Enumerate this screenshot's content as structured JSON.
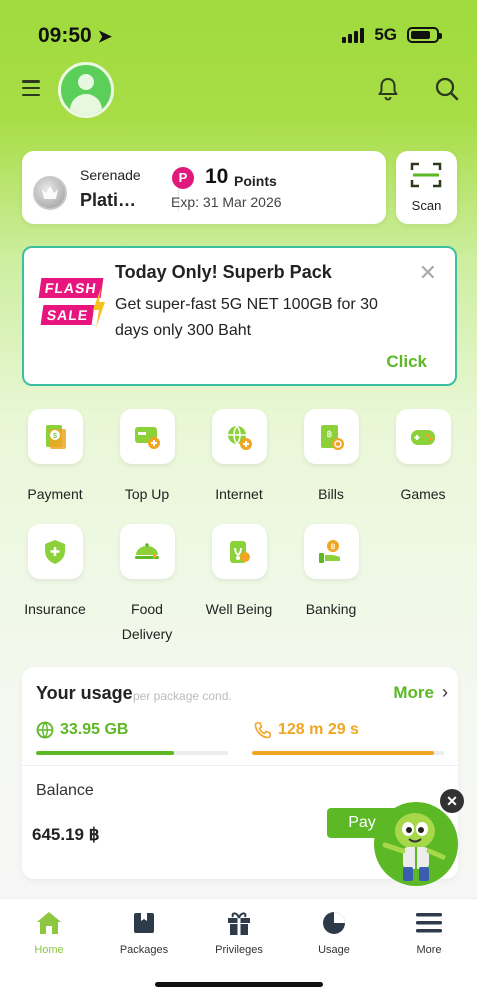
{
  "status_bar": {
    "time": "09:50",
    "location_icon": "location-arrow-icon",
    "network": "5G",
    "battery_level": 0.8
  },
  "header": {
    "menu_icon": "menu-icon",
    "avatar_icon": "avatar-icon",
    "notification_icon": "bell-icon",
    "search_icon": "search-icon"
  },
  "points": {
    "tier_name": "Serenade",
    "tier_level": "Plati…",
    "points_value": "10",
    "points_unit": "Points",
    "points_badge": "P",
    "expiry": "Exp: 31 Mar 2026"
  },
  "scan": {
    "label": "Scan",
    "icon": "scan-icon"
  },
  "promo": {
    "badge_line1": "FLASH",
    "badge_line2": "SALE",
    "title": "Today Only! Superb Pack",
    "description": "Get super-fast 5G NET 100GB for 30 days only 300 Baht",
    "cta": "Click",
    "close": "✕"
  },
  "services": [
    {
      "label": "Payment",
      "icon": "payment-icon"
    },
    {
      "label": "Top Up",
      "icon": "top-up-icon"
    },
    {
      "label": "Internet",
      "icon": "internet-icon"
    },
    {
      "label": "Bills",
      "icon": "bills-icon"
    },
    {
      "label": "Games",
      "icon": "games-icon"
    },
    {
      "label": "Insurance",
      "icon": "insurance-icon"
    },
    {
      "label": "Food Delivery",
      "icon": "food-delivery-icon"
    },
    {
      "label": "Well Being",
      "icon": "well-being-icon"
    },
    {
      "label": "Banking",
      "icon": "banking-icon"
    }
  ],
  "usage": {
    "title": "Your usage",
    "subtitle": "per package cond.",
    "more": "More",
    "data_value": "33.95 GB",
    "data_progress": 0.72,
    "call_value": "128 m 29 s",
    "call_progress": 0.95,
    "balance_label": "Balance",
    "balance_value": "645.19 ฿",
    "pay_label": "Pay"
  },
  "tabs": [
    {
      "label": "Home",
      "icon": "home-icon",
      "active": true
    },
    {
      "label": "Packages",
      "icon": "packages-icon",
      "active": false
    },
    {
      "label": "Privileges",
      "icon": "gift-icon",
      "active": false
    },
    {
      "label": "Usage",
      "icon": "pie-chart-icon",
      "active": false
    },
    {
      "label": "More",
      "icon": "more-menu-icon",
      "active": false
    }
  ],
  "colors": {
    "accent_green": "#5cb825",
    "header_green": "#9fdb3d",
    "promo_border": "#3cbfa1",
    "flash_pink": "#e8157f",
    "call_orange": "#f0a623"
  }
}
